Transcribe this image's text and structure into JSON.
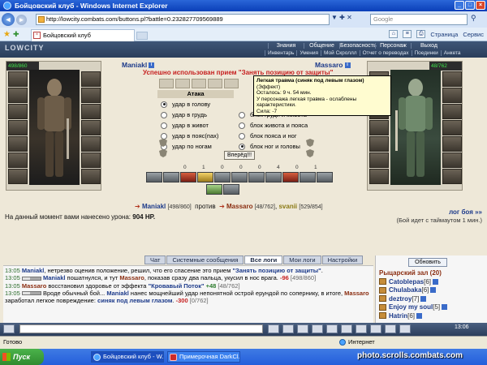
{
  "window": {
    "title": "Бойцовский клуб - Windows Internet Explorer",
    "url": "http://lowcity.combats.com/buttons.pl?battle=0.232827709569889",
    "search_placeholder": "Google",
    "tab_title": "Бойцовский клуб",
    "tools": [
      "Страница",
      "Сервис"
    ]
  },
  "game": {
    "logo": "LOWCITY",
    "menu_top": [
      "Знания",
      "Общение",
      "Безопасность",
      "Персонаж",
      "Выход"
    ],
    "menu_sub": [
      "Инвентарь",
      "Умения",
      "Мой Скроллл",
      "Отчет о переводах",
      "Поединки",
      "Анкета"
    ],
    "player_left": {
      "name": "Maniakl",
      "hp": "498/860",
      "mp": "375/375"
    },
    "player_right": {
      "name": "Massaro",
      "hp": "48/762",
      "mp": "354/354"
    },
    "success_msg": "Успешно использован прием \"Занять позицию от защиты\"",
    "tooltip": {
      "title": "Легкая травма (синяк под левым глазом)",
      "type": "(Эффект)",
      "remaining": "Осталось: 9 ч. 54 мин.",
      "desc": "У персонажа легкая травма - ослаблены характеристики.",
      "stat": "Сила: -7"
    },
    "attack_header": "Атака",
    "attacks": [
      "удар в голову",
      "удар в грудь",
      "удар в живот",
      "удар в пояс(пах)",
      "удар по ногам"
    ],
    "attack_selected": 0,
    "defenses": [
      "блок груди и живота",
      "блок живота и пояса",
      "блок пояса и ног",
      "блок ног и головы"
    ],
    "defense_selected": 3,
    "fight_button": "Вперёд!!!",
    "counters": [
      "0",
      "1",
      "0",
      "0",
      "0",
      "4",
      "0",
      "1"
    ],
    "vs": {
      "name1": "Maniakl",
      "lvl1": "[498/860]",
      "against": "против",
      "name2": "Massaro",
      "lvl2": "[48/762]",
      "name3": "svanii",
      "lvl3": "[529/854]"
    },
    "damage_text": "На данный момент вами нанесено урона:",
    "damage_value": "904 HP.",
    "log_link": "лог боя »»",
    "timeout": "(Бой идет с таймаутом 1 мин.)"
  },
  "chat": {
    "tabs": [
      "Чат",
      "Системные сообщения",
      "Все логи",
      "Мои логи",
      "Настройки"
    ],
    "active_tab": "Все логи",
    "lines": [
      {
        "time": "13:05",
        "parts": [
          {
            "cls": "a",
            "text": "Maniakl"
          },
          {
            "cls": "",
            "text": ", нетрезво оценив положение, решил, что его спасение это прием "
          },
          {
            "cls": "blue",
            "text": "\"Занять позицию от защиты\""
          },
          {
            "cls": "",
            "text": "."
          }
        ]
      },
      {
        "time": "13:05",
        "bar": true,
        "parts": [
          {
            "cls": "a",
            "text": "Maniakl"
          },
          {
            "cls": "",
            "text": " пошатнулся, и тут "
          },
          {
            "cls": "m",
            "text": "Massaro"
          },
          {
            "cls": "",
            "text": ", показав сразу два пальца, укусил в нос врага. "
          },
          {
            "cls": "dmg",
            "text": "-96"
          },
          {
            "cls": "hp",
            "text": " [498/860]"
          }
        ]
      },
      {
        "time": "13:05",
        "parts": [
          {
            "cls": "m",
            "text": "Massaro"
          },
          {
            "cls": "",
            "text": " восстановил здоровье от эффекта "
          },
          {
            "cls": "blue",
            "text": "\"Кровавый Поток\""
          },
          {
            "cls": "heal",
            "text": " +48"
          },
          {
            "cls": "hp",
            "text": " [48/762]"
          }
        ]
      },
      {
        "time": "13:05",
        "bar": true,
        "parts": [
          {
            "cls": "",
            "text": "Вроде обычный бой... "
          },
          {
            "cls": "a",
            "text": "Maniakl"
          },
          {
            "cls": "",
            "text": " нанес мощнейший удар непонятной острой ерундой по сопернику, в итоге, "
          },
          {
            "cls": "m",
            "text": "Massaro"
          },
          {
            "cls": "",
            "text": " заработал легкое повреждение: "
          },
          {
            "cls": "blue",
            "text": "синяк под левым глазом"
          },
          {
            "cls": "",
            "text": ". "
          },
          {
            "cls": "dmg",
            "text": "-300"
          },
          {
            "cls": "hp",
            "text": " [0/762]"
          }
        ]
      }
    ]
  },
  "room": {
    "refresh": "Обновить",
    "name": "Рыцарский зал (20)",
    "users": [
      {
        "name": "Catoblepas",
        "lvl": "[6]"
      },
      {
        "name": "Chulabaka",
        "lvl": "[6]"
      },
      {
        "name": "deztroy",
        "lvl": "[7]"
      },
      {
        "name": "Enjoy my soul",
        "lvl": "[5]"
      },
      {
        "name": "Hatrin",
        "lvl": "[6]"
      }
    ]
  },
  "gamebar": {
    "clock": "13:06"
  },
  "statusbar": {
    "left": "Готово",
    "zone": "Интернет"
  },
  "taskbar": {
    "start": "Пуск",
    "buttons": [
      "Бойцовский клуб - W...",
      "Примерочная DarkCl..."
    ]
  },
  "watermark": "photo.scrolls.combats.com"
}
